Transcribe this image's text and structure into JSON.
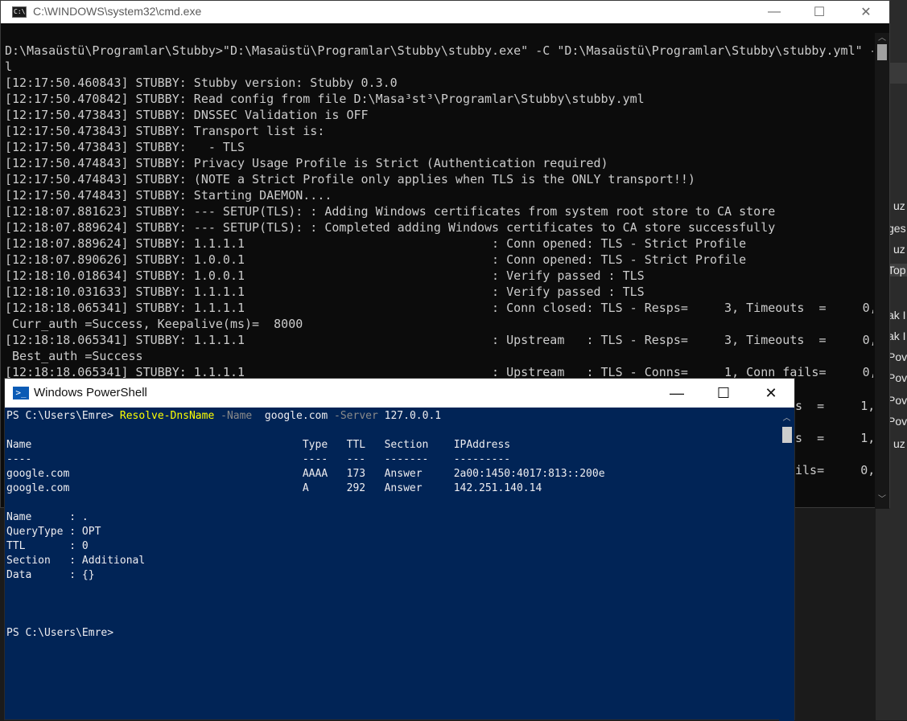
{
  "background_app": {
    "lines": [
      "uz",
      "ges",
      "uz",
      "Top",
      "ak I",
      "ak I",
      "Pov",
      "Pov",
      "Pov",
      "Pov",
      "uz"
    ]
  },
  "cmd": {
    "title": "C:\\WINDOWS\\system32\\cmd.exe",
    "minimize": "—",
    "maximize": "☐",
    "close": "✕",
    "lines": [
      "D:\\Masaüstü\\Programlar\\Stubby>\"D:\\Masaüstü\\Programlar\\Stubby\\stubby.exe\" -C \"D:\\Masaüstü\\Programlar\\Stubby\\stubby.yml\" -",
      "l",
      "[12:17:50.460843] STUBBY: Stubby version: Stubby 0.3.0",
      "[12:17:50.470842] STUBBY: Read config from file D:\\Masa³st³\\Programlar\\Stubby\\stubby.yml",
      "[12:17:50.473843] STUBBY: DNSSEC Validation is OFF",
      "[12:17:50.473843] STUBBY: Transport list is:",
      "[12:17:50.473843] STUBBY:   - TLS",
      "[12:17:50.474843] STUBBY: Privacy Usage Profile is Strict (Authentication required)",
      "[12:17:50.474843] STUBBY: (NOTE a Strict Profile only applies when TLS is the ONLY transport!!)",
      "[12:17:50.474843] STUBBY: Starting DAEMON....",
      "[12:18:07.881623] STUBBY: --- SETUP(TLS): : Adding Windows certificates from system root store to CA store",
      "[12:18:07.889624] STUBBY: --- SETUP(TLS): : Completed adding Windows certificates to CA store successfully",
      "[12:18:07.889624] STUBBY: 1.1.1.1                                  : Conn opened: TLS - Strict Profile",
      "[12:18:07.890626] STUBBY: 1.0.0.1                                  : Conn opened: TLS - Strict Profile",
      "[12:18:10.018634] STUBBY: 1.0.0.1                                  : Verify passed : TLS",
      "[12:18:10.031633] STUBBY: 1.1.1.1                                  : Verify passed : TLS",
      "[12:18:18.065341] STUBBY: 1.1.1.1                                  : Conn closed: TLS - Resps=     3, Timeouts  =     0,",
      " Curr_auth =Success, Keepalive(ms)=  8000",
      "[12:18:18.065341] STUBBY: 1.1.1.1                                  : Upstream   : TLS - Resps=     3, Timeouts  =     0,",
      " Best_auth =Success",
      "[12:18:18.065341] STUBBY: 1.1.1.1                                  : Upstream   : TLS - Conns=     1, Conn fails=     0,"
    ],
    "right_fragments": [
      "s  =     1,",
      "s  =     1,",
      "ils=     0,"
    ]
  },
  "powershell": {
    "title": "Windows PowerShell",
    "minimize": "—",
    "maximize": "☐",
    "close": "✕",
    "prompt": "PS C:\\Users\\Emre>",
    "command": "Resolve-DnsName",
    "arg_name_flag": "-Name",
    "arg_name_value": "google.com",
    "arg_server_flag": "-Server",
    "arg_server_value": "127.0.0.1",
    "table": {
      "header": "Name                                           Type   TTL   Section    IPAddress",
      "divider": "----                                           ----   ---   -------    ---------",
      "rows": [
        "google.com                                     AAAA   173   Answer     2a00:1450:4017:813::200e",
        "google.com                                     A      292   Answer     142.251.140.14"
      ]
    },
    "details": [
      "Name      : .",
      "QueryType : OPT",
      "TTL       : 0",
      "Section   : Additional",
      "Data      : {}"
    ],
    "final_prompt": "PS C:\\Users\\Emre>"
  }
}
